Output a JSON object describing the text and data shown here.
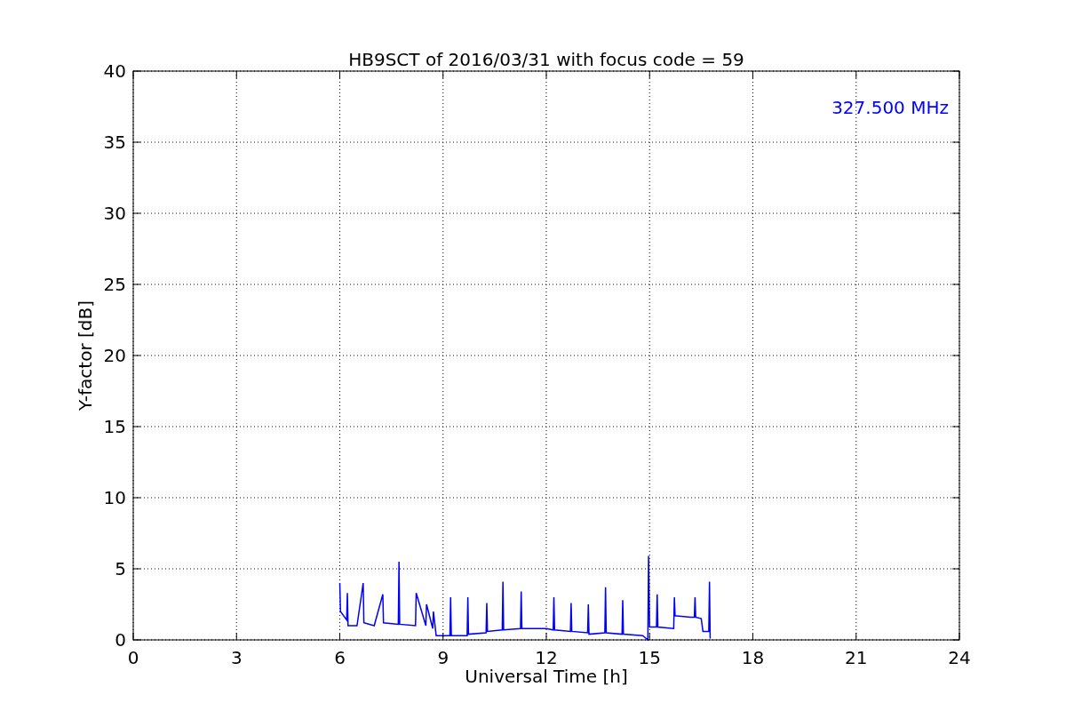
{
  "plot": {
    "chart_data": {
      "type": "line",
      "title": "HB9SCT of 2016/03/31 with focus code = 59",
      "xlabel": "Universal Time [h]",
      "ylabel": "Y-factor [dB]",
      "x": [
        6.0,
        6.02,
        6.2,
        6.22,
        6.24,
        6.5,
        6.68,
        6.7,
        7.0,
        7.25,
        7.27,
        7.7,
        7.72,
        7.74,
        8.2,
        8.22,
        8.5,
        8.52,
        8.7,
        8.72,
        8.8,
        9.2,
        9.22,
        9.24,
        9.7,
        9.72,
        9.74,
        10.25,
        10.27,
        10.29,
        10.72,
        10.74,
        10.76,
        11.25,
        11.27,
        11.29,
        12.0,
        12.2,
        12.22,
        12.24,
        12.7,
        12.72,
        12.74,
        13.2,
        13.22,
        13.24,
        13.7,
        13.72,
        13.74,
        14.2,
        14.22,
        14.24,
        14.8,
        14.95,
        14.97,
        15.0,
        15.2,
        15.22,
        15.24,
        15.7,
        15.72,
        15.74,
        16.2,
        16.3,
        16.32,
        16.34,
        16.5,
        16.55,
        16.72,
        16.74,
        16.76
      ],
      "series": [
        {
          "color": "#0000ff",
          "values": [
            4.0,
            2.0,
            1.4,
            3.3,
            1.0,
            1.0,
            4.0,
            1.2,
            1.0,
            3.2,
            1.2,
            1.1,
            5.5,
            1.1,
            1.0,
            3.3,
            1.0,
            2.5,
            0.8,
            2.0,
            0.3,
            0.3,
            3.0,
            0.3,
            0.3,
            3.0,
            0.4,
            0.5,
            2.6,
            0.6,
            0.7,
            4.1,
            0.7,
            0.8,
            3.4,
            0.8,
            0.8,
            0.7,
            3.0,
            0.7,
            0.6,
            2.6,
            0.6,
            0.5,
            2.5,
            0.4,
            0.5,
            3.7,
            0.5,
            0.4,
            2.8,
            0.4,
            0.3,
            0.0,
            5.9,
            0.9,
            0.9,
            3.2,
            0.9,
            0.8,
            3.0,
            1.7,
            1.6,
            1.6,
            3.0,
            1.6,
            1.5,
            0.6,
            0.6,
            4.1,
            0.1
          ]
        }
      ],
      "xlim": [
        0,
        24
      ],
      "ylim": [
        0,
        40
      ],
      "xticks": [
        0,
        3,
        6,
        9,
        12,
        15,
        18,
        21,
        24
      ],
      "yticks": [
        0,
        5,
        10,
        15,
        20,
        25,
        30,
        35,
        40
      ],
      "grid": true,
      "annotations": [
        {
          "text": "327.500 MHz"
        }
      ]
    }
  }
}
